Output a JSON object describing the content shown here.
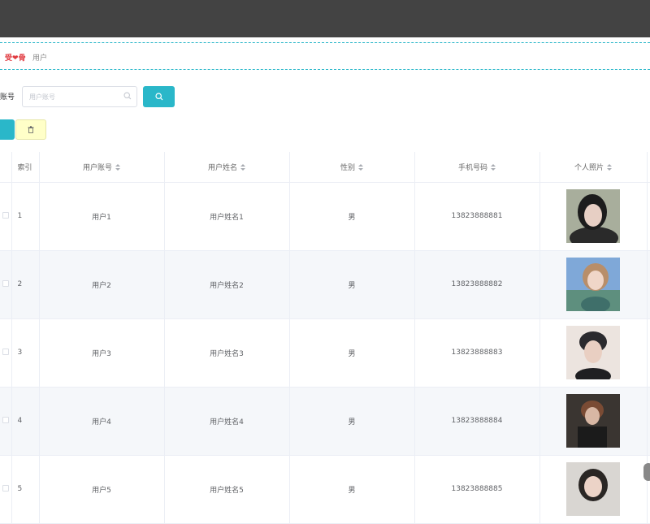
{
  "breadcrumb": {
    "home_pre": "受",
    "home_heart": "❤",
    "home_post": "骨",
    "current": "用户"
  },
  "search": {
    "label": "账号",
    "placeholder": "用户账号"
  },
  "table": {
    "columns": [
      "索引",
      "用户账号",
      "用户姓名",
      "性别",
      "手机号码",
      "个人照片"
    ],
    "rows": [
      {
        "index": "1",
        "account": "用户1",
        "name": "用户姓名1",
        "gender": "男",
        "phone": "13823888881"
      },
      {
        "index": "2",
        "account": "用户2",
        "name": "用户姓名2",
        "gender": "男",
        "phone": "13823888882"
      },
      {
        "index": "3",
        "account": "用户3",
        "name": "用户姓名3",
        "gender": "男",
        "phone": "13823888883"
      },
      {
        "index": "4",
        "account": "用户4",
        "name": "用户姓名4",
        "gender": "男",
        "phone": "13823888884"
      },
      {
        "index": "5",
        "account": "用户5",
        "name": "用户姓名5",
        "gender": "男",
        "phone": "13823888885"
      }
    ]
  },
  "colors": {
    "accent": "#2ab7c9",
    "topbar": "#434343",
    "delete_bg": "#ffffc8",
    "breadcrumb_home": "#e0383e"
  },
  "icons": {
    "search_input": "search-icon",
    "search_button": "search-icon",
    "delete_button": "trash-icon"
  }
}
